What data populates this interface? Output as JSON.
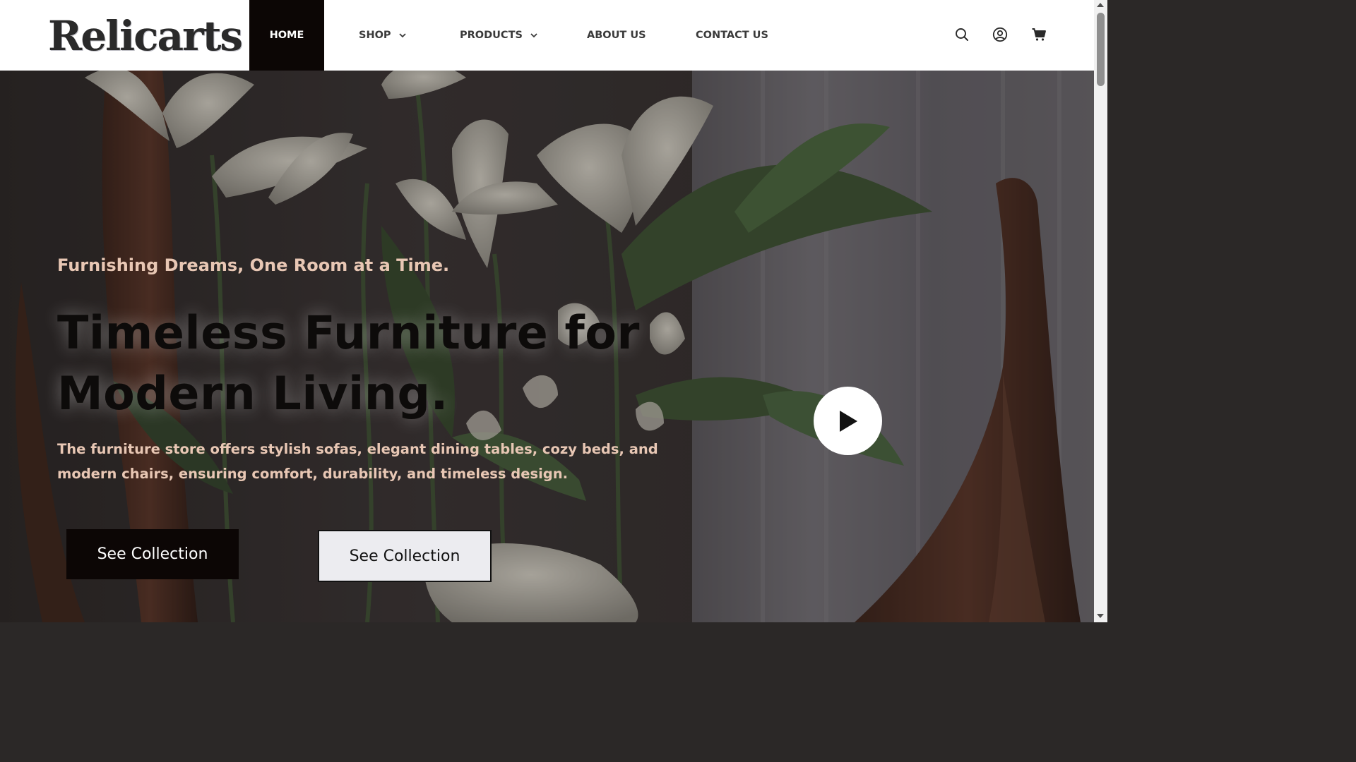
{
  "header": {
    "logo_text": "Relicarts",
    "nav": [
      {
        "label": "HOME",
        "active": true
      },
      {
        "label": "SHOP",
        "has_dropdown": true
      },
      {
        "label": "PRODUCTS",
        "has_dropdown": true
      },
      {
        "label": "ABOUT US"
      },
      {
        "label": "CONTACT US"
      }
    ],
    "icons": [
      "search-icon",
      "user-icon",
      "cart-icon"
    ]
  },
  "hero": {
    "tagline": "Furnishing Dreams, One Room at a Time.",
    "headline_line1": "Timeless Furniture for",
    "headline_line2": "Modern Living.",
    "description": "The furniture store offers stylish sofas, elegant dining tables, cozy beds, and modern chairs, ensuring comfort, durability, and timeless design.",
    "primary_button": "See Collection",
    "secondary_button": "See Collection",
    "play_icon": "play-icon"
  },
  "colors": {
    "accent_dark": "#0c0605",
    "tagline_color": "#e8c7b4",
    "header_bg": "#ffffff"
  }
}
